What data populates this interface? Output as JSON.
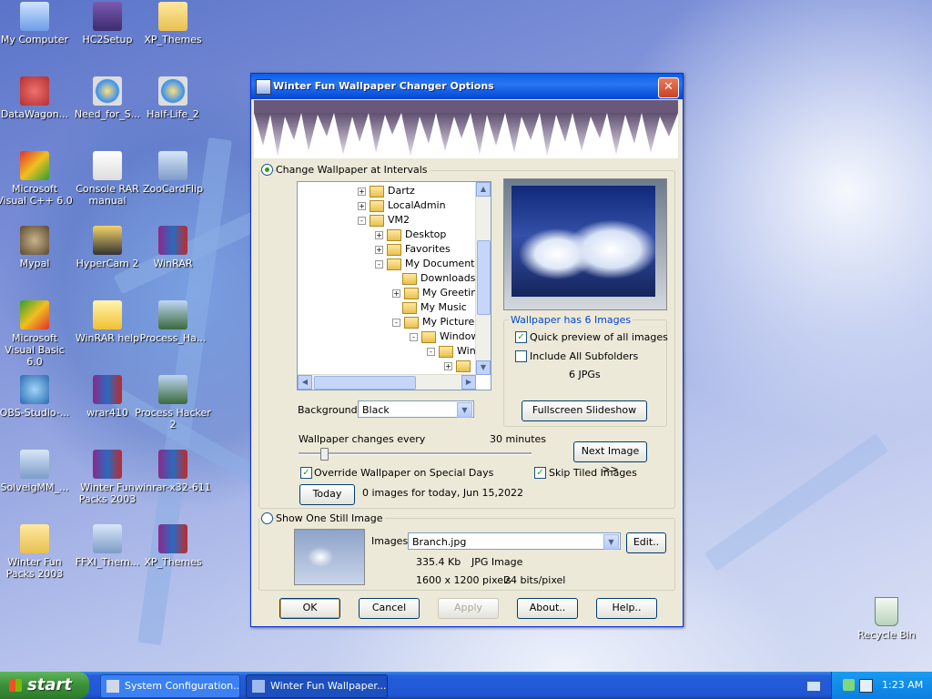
{
  "desktop": {
    "icons": [
      {
        "label": "My Computer",
        "icon": "computer-icon"
      },
      {
        "label": "HC2Setup",
        "icon": "installer-icon"
      },
      {
        "label": "XP_Themes",
        "icon": "folder-icon"
      },
      {
        "label": "DataWagon...",
        "icon": "shortcut-icon"
      },
      {
        "label": "Need_for_S...",
        "icon": "media-player-icon"
      },
      {
        "label": "Half-Life_2",
        "icon": "media-player-icon"
      },
      {
        "label": "Microsoft Visual C++ 6.0",
        "icon": "visual-cpp-icon"
      },
      {
        "label": "Console RAR manual",
        "icon": "document-icon"
      },
      {
        "label": "ZooCardFlip",
        "icon": "setup-icon"
      },
      {
        "label": "Mypal",
        "icon": "raccoon-icon"
      },
      {
        "label": "HyperCam 2",
        "icon": "camera-icon"
      },
      {
        "label": "WinRAR",
        "icon": "winrar-icon"
      },
      {
        "label": "Microsoft Visual Basic 6.0",
        "icon": "visual-basic-icon"
      },
      {
        "label": "WinRAR help",
        "icon": "help-icon"
      },
      {
        "label": "Process_Ha...",
        "icon": "process-hacker-icon"
      },
      {
        "label": "OBS-Studio-...",
        "icon": "obs-icon"
      },
      {
        "label": "wrar410",
        "icon": "winrar-icon"
      },
      {
        "label": "Process Hacker 2",
        "icon": "process-hacker-icon"
      },
      {
        "label": "SolveigMM_...",
        "icon": "setup-icon"
      },
      {
        "label": "Winter Fun Packs 2003",
        "icon": "winrar-icon"
      },
      {
        "label": "winrar-x32-611",
        "icon": "winrar-icon"
      },
      {
        "label": "Winter Fun Packs 2003",
        "icon": "folder-icon"
      },
      {
        "label": "FFXI_Them...",
        "icon": "setup-icon"
      },
      {
        "label": "XP_Themes",
        "icon": "winrar-icon"
      }
    ],
    "recycle_bin": "Recycle Bin"
  },
  "dialog": {
    "title": "Winter Fun Wallpaper Changer Options",
    "intervals_radio": "Change Wallpaper at Intervals",
    "tree": [
      {
        "label": "Dartz",
        "expander": "+"
      },
      {
        "label": "LocalAdmin",
        "expander": "+"
      },
      {
        "label": "VM2",
        "expander": "-"
      },
      {
        "label": "Desktop",
        "expander": "+"
      },
      {
        "label": "Favorites",
        "expander": "+"
      },
      {
        "label": "My Documents",
        "expander": "-"
      },
      {
        "label": "Downloads",
        "expander": ""
      },
      {
        "label": "My Greeting",
        "expander": "+"
      },
      {
        "label": "My Music",
        "expander": ""
      },
      {
        "label": "My Pictures",
        "expander": "-"
      },
      {
        "label": "Window",
        "expander": "-"
      },
      {
        "label": "Win",
        "expander": "-"
      },
      {
        "label": "",
        "expander": "+"
      }
    ],
    "wallpaper_group_title": "Wallpaper has 6 Images",
    "quick_preview": "Quick preview of all images",
    "include_subfolders": "Include All Subfolders",
    "jpg_count": "6 JPGs",
    "fullscreen_button": "Fullscreen Slideshow",
    "background_label": "Background",
    "background_value": "Black",
    "changes_label": "Wallpaper changes every",
    "changes_value": "30 minutes",
    "next_button": "Next Image >>",
    "override_label": "Override Wallpaper on Special Days",
    "skip_tiled_label": "Skip Tiled Images",
    "today_button": "Today",
    "today_info": "0 images for today, Jun 15,2022",
    "still_radio": "Show One Still Image",
    "images_label": "Images:",
    "images_value": "Branch.jpg",
    "edit_button": "Edit..",
    "file_size": "335.4 Kb",
    "file_type": "JPG Image",
    "dimensions": "1600 x 1200 pixels",
    "bit_depth": "24 bits/pixel",
    "ok": "OK",
    "cancel": "Cancel",
    "apply": "Apply",
    "about": "About..",
    "help": "Help.."
  },
  "taskbar": {
    "start": "start",
    "tasks": [
      "System Configuration...",
      "Winter Fun Wallpaper..."
    ],
    "clock": "1:23 AM"
  }
}
